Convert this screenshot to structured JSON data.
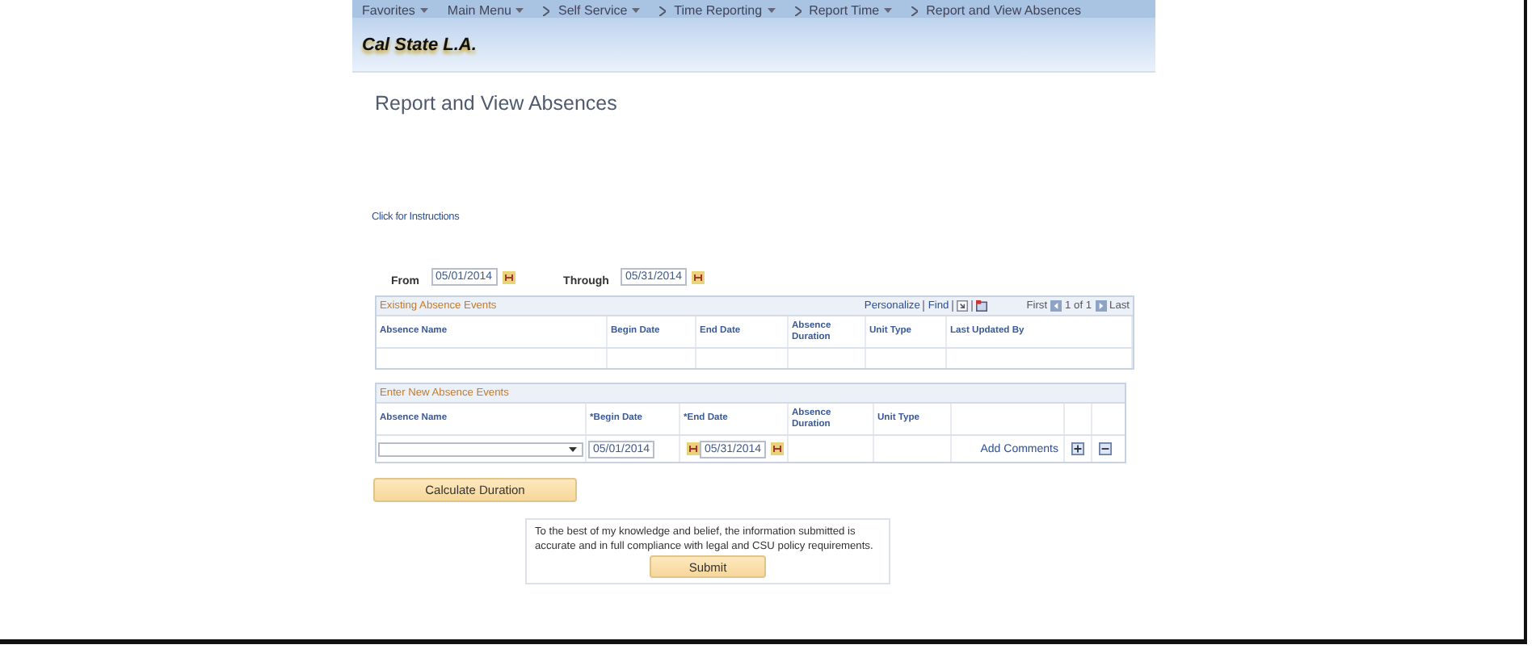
{
  "breadcrumbs": [
    {
      "label": "Favorites",
      "has_menu": true,
      "separator": false
    },
    {
      "label": "Main Menu",
      "has_menu": true,
      "separator": false
    },
    {
      "label": "Self Service",
      "has_menu": true,
      "separator": true
    },
    {
      "label": "Time Reporting",
      "has_menu": true,
      "separator": true
    },
    {
      "label": "Report Time",
      "has_menu": true,
      "separator": true
    },
    {
      "label": "Report and View Absences",
      "has_menu": false,
      "separator": true
    }
  ],
  "logo": "Cal State L.A.",
  "page_title": "Report and View Absences",
  "instructions_link": "Click for Instructions",
  "date_range": {
    "from_label": "From",
    "from_value": "05/01/2014",
    "through_label": "Through",
    "through_value": "05/31/2014"
  },
  "existing_events": {
    "title": "Existing Absence Events",
    "toolbar": {
      "personalize": "Personalize",
      "find": "Find",
      "first": "First",
      "page_info": "1 of 1",
      "last": "Last"
    },
    "columns": [
      "Absence Name",
      "Begin Date",
      "End Date",
      "Absence Duration",
      "Unit Type",
      "Last Updated By"
    ]
  },
  "new_events": {
    "title": "Enter New Absence Events",
    "columns": [
      "Absence Name",
      "*Begin Date",
      "*End Date",
      "Absence Duration",
      "Unit Type"
    ],
    "rows": [
      {
        "begin_date": "05/01/2014",
        "end_date": "05/31/2014",
        "comments_link": "Add Comments"
      }
    ]
  },
  "calculate_button": "Calculate Duration",
  "attestation": {
    "text": "To the best of my knowledge and belief, the information submitted is accurate and in full compliance with legal and CSU policy requirements.",
    "button": "Submit"
  }
}
